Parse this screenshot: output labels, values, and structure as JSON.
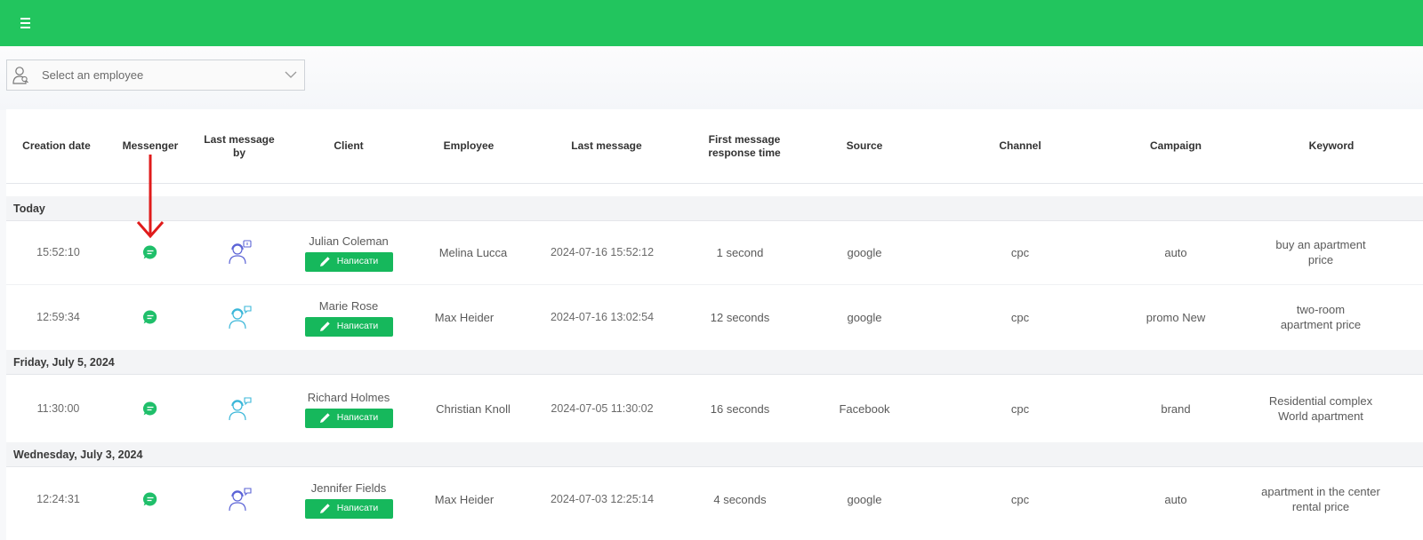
{
  "header": {
    "menu_icon": "hamburger-icon",
    "color": "#22c55e"
  },
  "filter": {
    "placeholder": "Select an employee",
    "icon": "user-search-icon"
  },
  "columns": [
    "Creation date",
    "Messenger",
    "Last message by",
    "Client",
    "Employee",
    "Last message",
    "First message response time",
    "Source",
    "Channel",
    "Campaign",
    "Keyword"
  ],
  "write_button_label": "Написати",
  "groups": [
    {
      "label": "Today"
    },
    {
      "label": "Friday, July 5, 2024"
    },
    {
      "label": "Wednesday, July 3, 2024"
    }
  ],
  "rows": [
    {
      "time": "15:52:10",
      "client": "Julian Coleman",
      "employee": "Melina Lucca",
      "last_message": "2024-07-16 15:52:12",
      "response": "1 second",
      "source": "google",
      "channel": "cpc",
      "campaign": "auto",
      "keyword": "buy an apartment price",
      "agent_color": "#5b63d6"
    },
    {
      "time": "12:59:34",
      "client": "Marie Rose",
      "employee": "Max Heider",
      "last_message": "2024-07-16 13:02:54",
      "response": "12 seconds",
      "source": "google",
      "channel": "cpc",
      "campaign": "promo New",
      "keyword": "two-room apartment price",
      "agent_color": "#3bb7d9"
    },
    {
      "time": "11:30:00",
      "client": "Richard Holmes",
      "employee": "Christian Knoll",
      "last_message": "2024-07-05 11:30:02",
      "response": "16 seconds",
      "source": "Facebook",
      "channel": "cpc",
      "campaign": "brand",
      "keyword": "Residential complex World apartment",
      "agent_color": "#3bb7d9"
    },
    {
      "time": "12:24:31",
      "client": "Jennifer Fields",
      "employee": "Max Heider",
      "last_message": "2024-07-03 12:25:14",
      "response": "4 seconds",
      "source": "google",
      "channel": "cpc",
      "campaign": "auto",
      "keyword": "apartment in the center rental price",
      "agent_color": "#5b63d6"
    }
  ],
  "annotation": {
    "type": "arrow",
    "color": "#e01b1b",
    "points_to": "Messenger"
  },
  "colors": {
    "accent": "#22c55e",
    "button": "#16b85c",
    "messenger_icon": "#1fbf6a"
  }
}
